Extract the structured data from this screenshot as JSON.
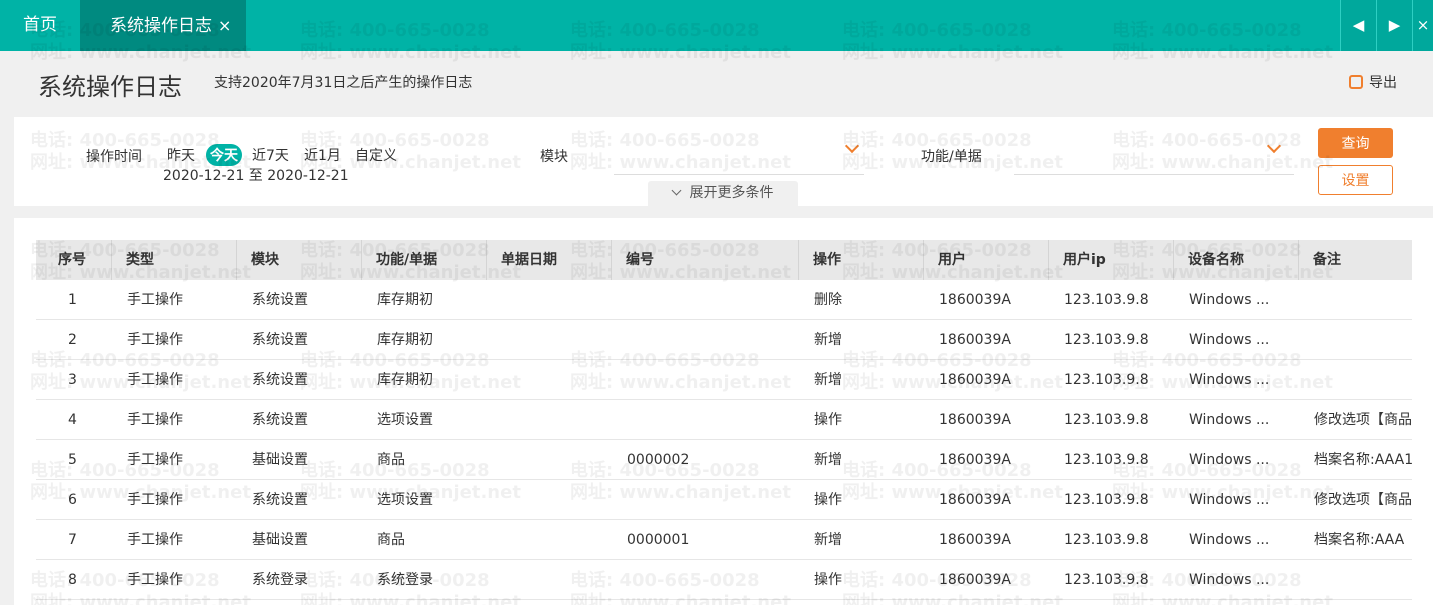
{
  "tabs": {
    "home": "首页",
    "active": "系统操作日志",
    "close_glyph": "×",
    "prev_glyph": "◀",
    "next_glyph": "▶",
    "close_all_glyph": "×"
  },
  "header": {
    "title": "系统操作日志",
    "subtitle": "支持2020年7月31日之后产生的操作日志",
    "export_label": "导出"
  },
  "filter": {
    "time_label": "操作时间",
    "quick_options": [
      "昨天",
      "今天",
      "近7天",
      "近1月",
      "自定义"
    ],
    "selected_quick": "今天",
    "date_range": "2020-12-21 至 2020-12-21",
    "module_label": "模块",
    "module_value": "",
    "function_label": "功能/单据",
    "function_value": "",
    "query_button": "查询",
    "settings_button": "设置",
    "expand_label": "展开更多条件"
  },
  "table": {
    "columns": [
      "序号",
      "类型",
      "模块",
      "功能/单据",
      "单据日期",
      "编号",
      "操作",
      "用户",
      "用户ip",
      "设备名称",
      "备注"
    ],
    "rows": [
      [
        "1",
        "手工操作",
        "系统设置",
        "库存期初",
        "",
        "",
        "删除",
        "1860039A",
        "123.103.9.8",
        "Windows ...",
        ""
      ],
      [
        "2",
        "手工操作",
        "系统设置",
        "库存期初",
        "",
        "",
        "新增",
        "1860039A",
        "123.103.9.8",
        "Windows ...",
        ""
      ],
      [
        "3",
        "手工操作",
        "系统设置",
        "库存期初",
        "",
        "",
        "新增",
        "1860039A",
        "123.103.9.8",
        "Windows ...",
        ""
      ],
      [
        "4",
        "手工操作",
        "系统设置",
        "选项设置",
        "",
        "",
        "操作",
        "1860039A",
        "123.103.9.8",
        "Windows ...",
        "修改选项【商品"
      ],
      [
        "5",
        "手工操作",
        "基础设置",
        "商品",
        "",
        "0000002",
        "新增",
        "1860039A",
        "123.103.9.8",
        "Windows ...",
        "档案名称:AAA1"
      ],
      [
        "6",
        "手工操作",
        "系统设置",
        "选项设置",
        "",
        "",
        "操作",
        "1860039A",
        "123.103.9.8",
        "Windows ...",
        "修改选项【商品"
      ],
      [
        "7",
        "手工操作",
        "基础设置",
        "商品",
        "",
        "0000001",
        "新增",
        "1860039A",
        "123.103.9.8",
        "Windows ...",
        "档案名称:AAA"
      ],
      [
        "8",
        "手工操作",
        "系统登录",
        "系统登录",
        "",
        "",
        "操作",
        "1860039A",
        "123.103.9.8",
        "Windows ...",
        ""
      ]
    ]
  },
  "watermark": {
    "phone": "电话: 400-665-0028",
    "site": "网址: www.chanjet.net"
  },
  "colors": {
    "brand_teal": "#00b3a6",
    "active_tab": "#008a80",
    "accent_orange": "#f07f2e"
  }
}
